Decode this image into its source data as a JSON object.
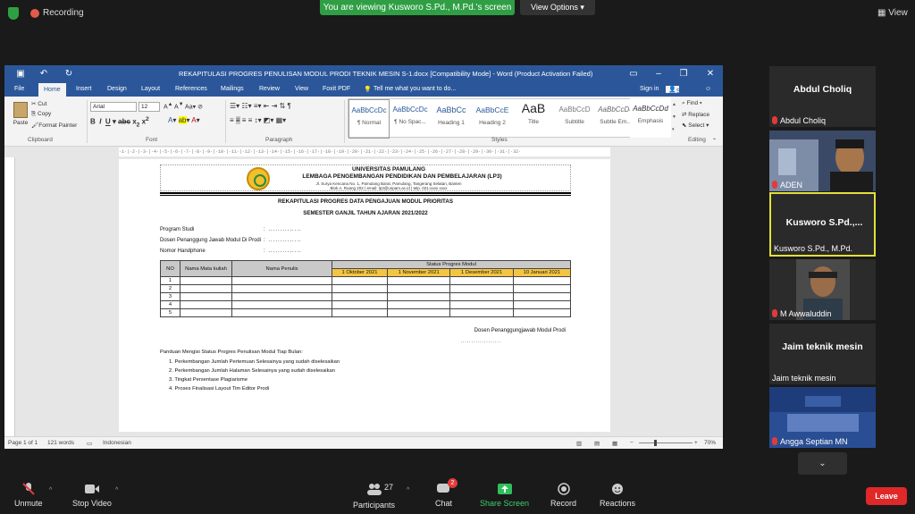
{
  "zoom_meeting": {
    "recording_label": "Recording",
    "viewing_banner": "You are viewing Kusworo S.Pd., M.Pd.'s screen",
    "view_options_label": "View Options",
    "view_label": "View"
  },
  "word": {
    "title": "REKAPITULASI PROGRES PENULISAN MODUL PRODI TEKNIK MESIN S-1.docx [Compatibility Mode] - Word (Product Activation Failed)",
    "tabs": [
      "File",
      "Home",
      "Insert",
      "Design",
      "Layout",
      "References",
      "Mailings",
      "Review",
      "View",
      "Foxit PDF"
    ],
    "tell_me": "Tell me what you want to do...",
    "sign_in": "Sign in",
    "share": "Share",
    "clipboard": {
      "paste": "Paste",
      "cut": "Cut",
      "copy": "Copy",
      "format_painter": "Format Painter",
      "group": "Clipboard"
    },
    "font": {
      "name": "Arial",
      "size": "12",
      "group": "Font"
    },
    "paragraph_group": "Paragraph",
    "styles_group": "Styles",
    "editing": {
      "find": "Find",
      "replace": "Replace",
      "select": "Select",
      "group": "Editing"
    },
    "styles": [
      {
        "preview": "AaBbCcDc",
        "name": "¶ Normal"
      },
      {
        "preview": "AaBbCcDc",
        "name": "¶ No Spac..."
      },
      {
        "preview": "AaBbCc",
        "name": "Heading 1"
      },
      {
        "preview": "AaBbCcE",
        "name": "Heading 2"
      },
      {
        "preview": "AaB",
        "name": "Title"
      },
      {
        "preview": "AaBbCcD",
        "name": "Subtitle"
      },
      {
        "preview": "AaBbCcDd",
        "name": "Subtle Em..."
      },
      {
        "preview": "AaBbCcDd",
        "name": "Emphasis"
      }
    ],
    "status": {
      "page": "Page 1 of 1",
      "words": "121 words",
      "language": "Indonesian",
      "zoom": "70%"
    },
    "document": {
      "university": "UNIVERSITAS PAMULANG",
      "institution": "LEMBAGA PENGEMBANGAN PENDIDIKAN DAN PEMBELAJARAN (LP3)",
      "address_line1": "Jl. Surya Kencana No. 1, Pamulang Barat, Pamulang, Tangerang Selatan, Banten",
      "address_line2": "Blok A, Ruang 202 | email: lp3@unpam.ac.id | telp. 021-xxxx xxxx",
      "title": "REKAPITULASI PROGRES DATA PENGAJUAN MODUL PRIORITAS",
      "semester": "SEMESTER GANJIL TAHUN AJARAN 2021/2022",
      "fields": [
        {
          "label": "Program Studi",
          "value": ": .............."
        },
        {
          "label": "Dosen Penanggung Jawab Modul Di Prodi",
          "value": ": .............."
        },
        {
          "label": "Nomor Handphone",
          "value": ": .............."
        }
      ],
      "table": {
        "headers": [
          "NO",
          "Nama Mata kuliah",
          "Nama Penulis",
          "Status Progres Modul"
        ],
        "dates": [
          "1 Oktober 2021",
          "1 November 2021",
          "1 Desember 2021",
          "10 Januari 2021"
        ],
        "rows": [
          "1",
          "2",
          "3",
          "4",
          "5"
        ]
      },
      "signature_label": "Dosen Penanggungjawab Modul Prodi",
      "signature_dots": "...................",
      "guide_title": "Panduan Mengisi Status Progres Penulisan Modul Tiap Bulan:",
      "guide_items": [
        "1.   Perkembangan Jumlah Pertemuan Selesainya yang sudah diselesaikan",
        "2.   Perkembangan Jumlah Halaman Selesainya yang sudah diselesaikan",
        "3.   Tingkat Persentase Plagiarisme",
        "4.   Proses Finalisasi Layout Tim Editor Prodi"
      ]
    }
  },
  "participants": [
    {
      "display": "Abdul Choliq",
      "name": "Abdul Choliq",
      "video": false
    },
    {
      "display": "",
      "name": "ADEN",
      "video": true
    },
    {
      "display": "Kusworo  S.Pd.,...",
      "name": "Kusworo S.Pd., M.Pd.",
      "video": false
    },
    {
      "display": "",
      "name": "M Awwaluddin",
      "video": true
    },
    {
      "display": "Jaim teknik mesin",
      "name": "Jaim teknik mesin",
      "video": false
    },
    {
      "display": "",
      "name": "Angga Septian MN",
      "video": true
    }
  ],
  "toolbar": {
    "unmute": "Unmute",
    "stop_video": "Stop Video",
    "participants": "Participants",
    "participant_count": "27",
    "chat": "Chat",
    "chat_badge": "2",
    "share_screen": "Share Screen",
    "record": "Record",
    "reactions": "Reactions",
    "leave": "Leave"
  },
  "colors": {
    "word_blue": "#2b579a",
    "zoom_green": "#2f9e44",
    "leave_red": "#e02828",
    "active_border": "#e3e03a"
  }
}
